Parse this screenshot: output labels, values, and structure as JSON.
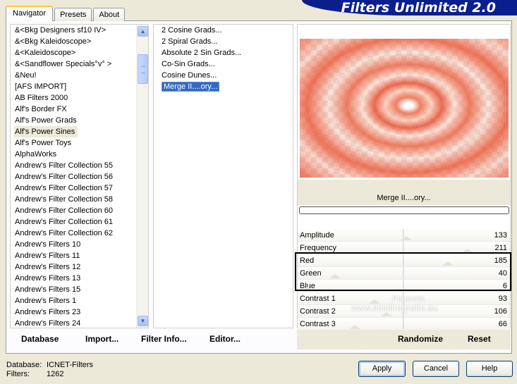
{
  "title": "Filters Unlimited 2.0",
  "tabs": [
    {
      "label": "Navigator",
      "active": true
    },
    {
      "label": "Presets",
      "active": false
    },
    {
      "label": "About",
      "active": false
    }
  ],
  "categories": {
    "items": [
      "&<Bkg Designers sf10 IV>",
      "&<Bkg Kaleidoscope>",
      "&<Kaleidoscope>",
      "&<Sandflower Specials°v° >",
      "&Neu!",
      "[AFS IMPORT]",
      "AB Filters 2000",
      "Alf's Border FX",
      "Alf's Power Grads",
      "Alf's Power Sines",
      "Alf's Power Toys",
      "AlphaWorks",
      "Andrew's Filter Collection 55",
      "Andrew's Filter Collection 56",
      "Andrew's Filter Collection 57",
      "Andrew's Filter Collection 58",
      "Andrew's Filter Collection 60",
      "Andrew's Filter Collection 61",
      "Andrew's Filter Collection 62",
      "Andrew's Filters 10",
      "Andrew's Filters 11",
      "Andrew's Filters 12",
      "Andrew's Filters 13",
      "Andrew's Filters 15",
      "Andrew's Filters 1",
      "Andrew's Filters 23",
      "Andrew's Filters 24"
    ],
    "selected_index": 9
  },
  "filters": {
    "items": [
      "2 Cosine Grads...",
      "2 Spiral Grads...",
      "Absolute 2 Sin Grads...",
      "Co-Sin Grads...",
      "Cosine Dunes...",
      "Merge II....ory..."
    ],
    "selected_index": 5
  },
  "preview": {
    "filter_name": "Merge II....ory..."
  },
  "sliders": [
    {
      "label": "Amplitude",
      "value": "133",
      "level": 0.52
    },
    {
      "label": "Frequency",
      "value": "211",
      "level": 0.83
    },
    {
      "label": "Red",
      "value": "185",
      "level": 0.73
    },
    {
      "label": "Green",
      "value": "40",
      "level": 0.16
    },
    {
      "label": "Blue",
      "value": "6",
      "level": 0.02
    },
    {
      "label": "Contrast 1",
      "value": "93",
      "level": 0.36
    },
    {
      "label": "Contrast 2",
      "value": "106",
      "level": 0.42
    },
    {
      "label": "Contrast 3",
      "value": "66",
      "level": 0.26
    }
  ],
  "watermark": {
    "line1": "Pinuccia",
    "line2": "www.misiliregrafie.eu"
  },
  "actions": {
    "database": "Database",
    "import": "Import...",
    "filter_info": "Filter Info...",
    "editor": "Editor...",
    "randomize": "Randomize",
    "reset": "Reset"
  },
  "footer": {
    "database_label": "Database:",
    "database_value": "ICNET-Filters",
    "filters_label": "Filters:",
    "filters_value": "1262",
    "apply": "Apply",
    "cancel": "Cancel",
    "help": "Help"
  },
  "colors": {
    "banner": "#0b1f8c",
    "selection": "#316ac5",
    "window": "#ece9d8"
  }
}
